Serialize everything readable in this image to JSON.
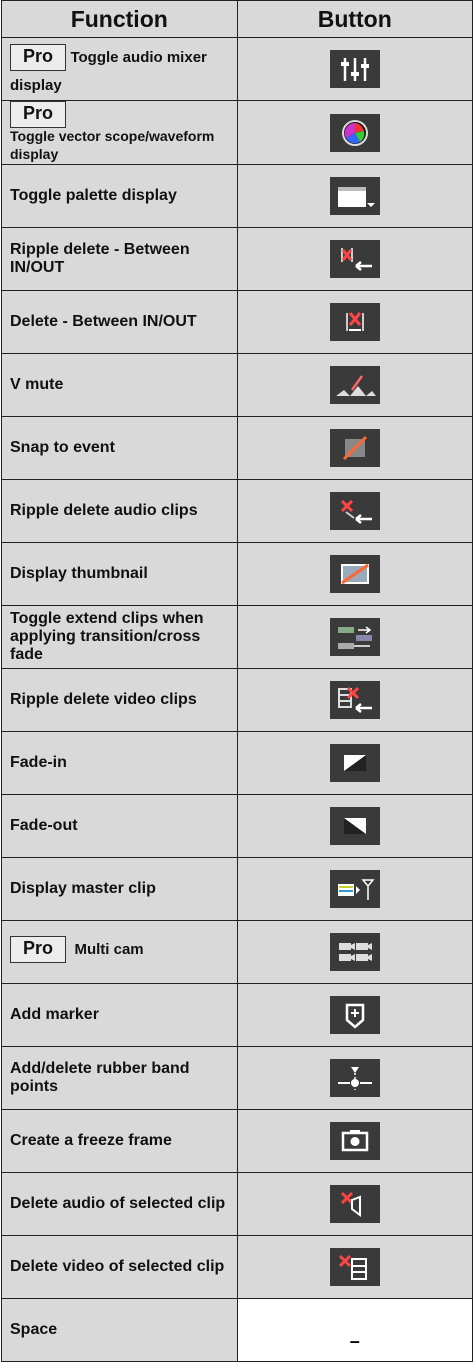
{
  "header": {
    "function": "Function",
    "button": "Button"
  },
  "pro_label": "Pro",
  "rows": [
    {
      "function": "Toggle audio mixer display",
      "pro": true,
      "icon": "audio-mixer-icon"
    },
    {
      "function": "Toggle vector scope/waveform display",
      "pro": true,
      "icon": "vector-scope-icon"
    },
    {
      "function": "Toggle palette display",
      "icon": "palette-icon"
    },
    {
      "function": "Ripple delete - Between IN/OUT",
      "icon": "ripple-delete-in-out-icon"
    },
    {
      "function": "Delete - Between IN/OUT",
      "icon": "delete-in-out-icon"
    },
    {
      "function": "V mute",
      "icon": "v-mute-icon"
    },
    {
      "function": "Snap to event",
      "icon": "snap-to-event-icon"
    },
    {
      "function": "Ripple delete audio clips",
      "icon": "ripple-delete-audio-icon"
    },
    {
      "function": "Display thumbnail",
      "icon": "display-thumbnail-icon"
    },
    {
      "function": "Toggle extend clips when applying transition/cross fade",
      "icon": "extend-clips-icon"
    },
    {
      "function": "Ripple delete video clips",
      "icon": "ripple-delete-video-icon"
    },
    {
      "function": "Fade-in",
      "icon": "fade-in-icon"
    },
    {
      "function": "Fade-out",
      "icon": "fade-out-icon"
    },
    {
      "function": "Display master clip",
      "icon": "master-clip-icon"
    },
    {
      "function": "Multi cam",
      "pro": true,
      "icon": "multi-cam-icon"
    },
    {
      "function": "Add marker",
      "icon": "add-marker-icon"
    },
    {
      "function": "Add/delete rubber band points",
      "icon": "rubber-band-points-icon"
    },
    {
      "function": "Create a freeze frame",
      "icon": "freeze-frame-icon"
    },
    {
      "function": "Delete audio of selected clip",
      "icon": "delete-audio-icon"
    },
    {
      "function": "Delete video of selected clip",
      "icon": "delete-video-icon"
    },
    {
      "function": "Space",
      "button_text": "–"
    }
  ]
}
